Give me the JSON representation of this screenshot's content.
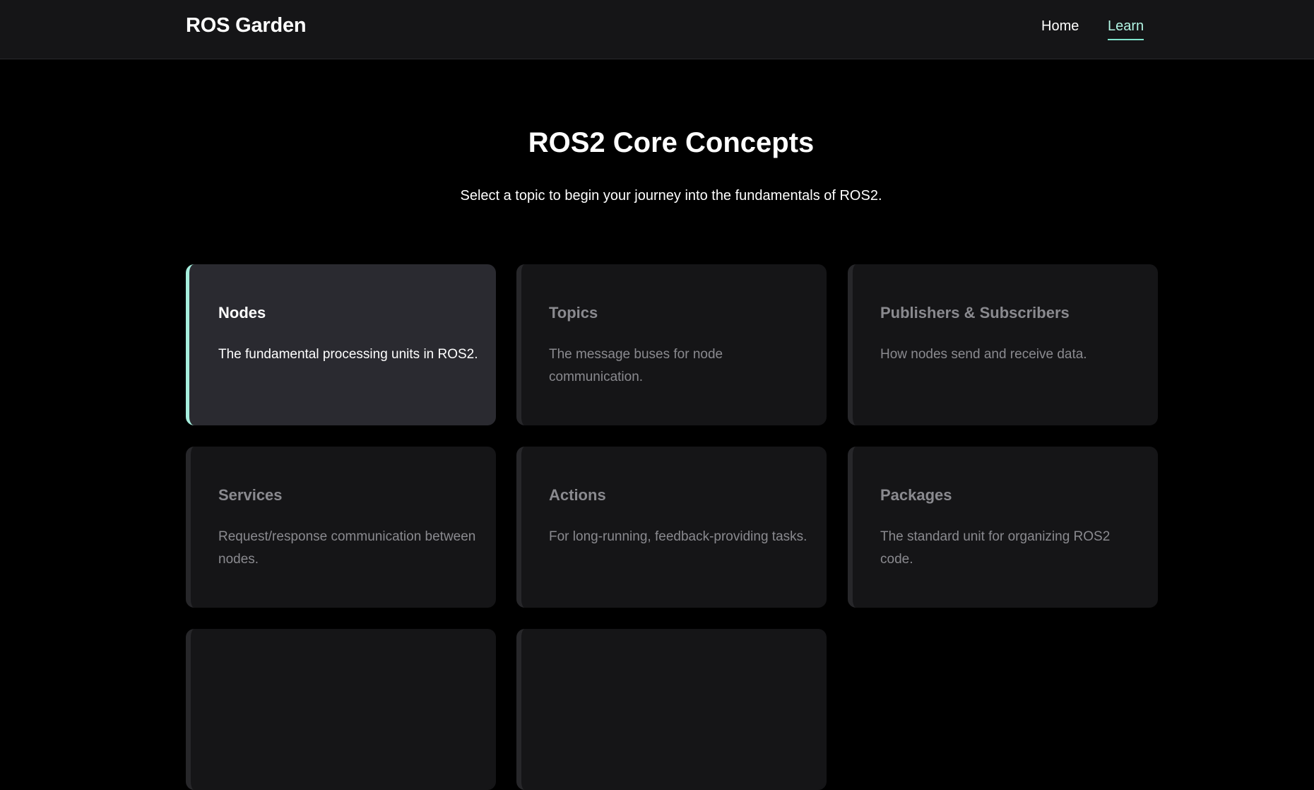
{
  "header": {
    "brand": "ROS Garden",
    "nav": [
      {
        "label": "Home"
      },
      {
        "label": "Learn",
        "active": true
      }
    ]
  },
  "main": {
    "title": "ROS2 Core Concepts",
    "subtitle": "Select a topic to begin your journey into the fundamentals of ROS2.",
    "cards": [
      {
        "title": "Nodes",
        "description": "The fundamental processing units in ROS2.",
        "active": true
      },
      {
        "title": "Topics",
        "description": "The message buses for node communication."
      },
      {
        "title": "Publishers & Subscribers",
        "description": "How nodes send and receive data."
      },
      {
        "title": "Services",
        "description": "Request/response communication between nodes."
      },
      {
        "title": "Actions",
        "description": "For long-running, feedback-providing tasks."
      },
      {
        "title": "Packages",
        "description": "The standard unit for organizing ROS2 code."
      }
    ]
  },
  "colors": {
    "accent": "#7fe3cc",
    "background": "#000000",
    "header_bg": "#151517",
    "card_bg": "#151517",
    "card_active_bg": "#2a2a30",
    "muted_text": "#8a8a8f"
  }
}
